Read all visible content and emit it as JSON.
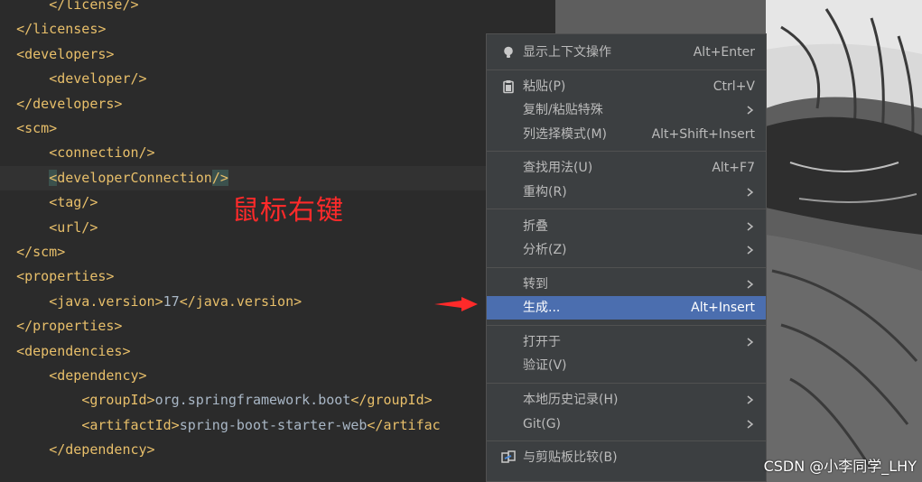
{
  "editor": {
    "lines": [
      {
        "indent": "    ",
        "segments": [
          {
            "t": "</license/>",
            "c": "tag"
          }
        ]
      },
      {
        "indent": "",
        "segments": [
          {
            "t": "</licenses>",
            "c": "tag"
          }
        ]
      },
      {
        "indent": "",
        "segments": [
          {
            "t": "<developers>",
            "c": "tag"
          }
        ]
      },
      {
        "indent": "    ",
        "segments": [
          {
            "t": "<developer/>",
            "c": "tag"
          }
        ]
      },
      {
        "indent": "",
        "segments": [
          {
            "t": "</developers>",
            "c": "tag"
          }
        ]
      },
      {
        "indent": "",
        "segments": [
          {
            "t": "<scm>",
            "c": "tag"
          }
        ]
      },
      {
        "indent": "    ",
        "segments": [
          {
            "t": "<connection/>",
            "c": "tag"
          }
        ]
      },
      {
        "indent": "    ",
        "current": true,
        "segments": [
          {
            "t": "<",
            "c": "hl-tag"
          },
          {
            "t": "developerConnection",
            "c": "tag"
          },
          {
            "t": "/>",
            "c": "hl-tag"
          }
        ]
      },
      {
        "indent": "    ",
        "segments": [
          {
            "t": "<tag/>",
            "c": "tag"
          }
        ]
      },
      {
        "indent": "    ",
        "segments": [
          {
            "t": "<url/>",
            "c": "tag"
          }
        ]
      },
      {
        "indent": "",
        "segments": [
          {
            "t": "</scm>",
            "c": "tag"
          }
        ]
      },
      {
        "indent": "",
        "segments": [
          {
            "t": "<properties>",
            "c": "tag"
          }
        ]
      },
      {
        "indent": "    ",
        "segments": [
          {
            "t": "<java.version>",
            "c": "tag"
          },
          {
            "t": "17",
            "c": "txt"
          },
          {
            "t": "</java.version>",
            "c": "tag"
          }
        ]
      },
      {
        "indent": "",
        "segments": [
          {
            "t": "</properties>",
            "c": "tag"
          }
        ]
      },
      {
        "indent": "",
        "segments": [
          {
            "t": "<dependencies>",
            "c": "tag"
          }
        ]
      },
      {
        "indent": "    ",
        "segments": [
          {
            "t": "<dependency>",
            "c": "tag"
          }
        ]
      },
      {
        "indent": "        ",
        "segments": [
          {
            "t": "<groupId>",
            "c": "tag"
          },
          {
            "t": "org.springframework.boot",
            "c": "txt"
          },
          {
            "t": "</groupId>",
            "c": "tag"
          }
        ]
      },
      {
        "indent": "        ",
        "segments": [
          {
            "t": "<artifactId>",
            "c": "tag"
          },
          {
            "t": "spring-boot-starter-web",
            "c": "txt"
          },
          {
            "t": "</artifac",
            "c": "tag"
          }
        ]
      },
      {
        "indent": "    ",
        "segments": [
          {
            "t": "</dependency>",
            "c": "tag"
          }
        ]
      }
    ]
  },
  "annotation": "鼠标右键",
  "context_menu": {
    "items": [
      {
        "label": "显示上下文操作",
        "shortcut": "Alt+Enter",
        "icon": "lightbulb-icon"
      },
      {
        "separator": true
      },
      {
        "label": "粘贴(P)",
        "shortcut": "Ctrl+V",
        "icon": "clipboard-icon"
      },
      {
        "label": "复制/粘贴特殊",
        "submenu": true
      },
      {
        "label": "列选择模式(M)",
        "shortcut": "Alt+Shift+Insert"
      },
      {
        "separator": true
      },
      {
        "label": "查找用法(U)",
        "shortcut": "Alt+F7"
      },
      {
        "label": "重构(R)",
        "submenu": true
      },
      {
        "separator": true
      },
      {
        "label": "折叠",
        "submenu": true
      },
      {
        "label": "分析(Z)",
        "submenu": true
      },
      {
        "separator": true
      },
      {
        "label": "转到",
        "submenu": true
      },
      {
        "label": "生成...",
        "shortcut": "Alt+Insert",
        "selected": true
      },
      {
        "separator": true
      },
      {
        "label": "打开于",
        "submenu": true
      },
      {
        "label": "验证(V)"
      },
      {
        "separator": true
      },
      {
        "label": "本地历史记录(H)",
        "submenu": true
      },
      {
        "label": "Git(G)",
        "submenu": true
      },
      {
        "separator": true
      },
      {
        "label": "与剪贴板比较(B)",
        "icon": "compare-icon"
      }
    ]
  },
  "watermark": "CSDN @小李同学_LHY",
  "colors": {
    "editor_bg": "#2b2b2b",
    "tag": "#e8bf6a",
    "text": "#a9b7c6",
    "menu_bg": "#3c3f41",
    "menu_selected": "#4b6eaf",
    "annotation": "#ff2a2a"
  }
}
